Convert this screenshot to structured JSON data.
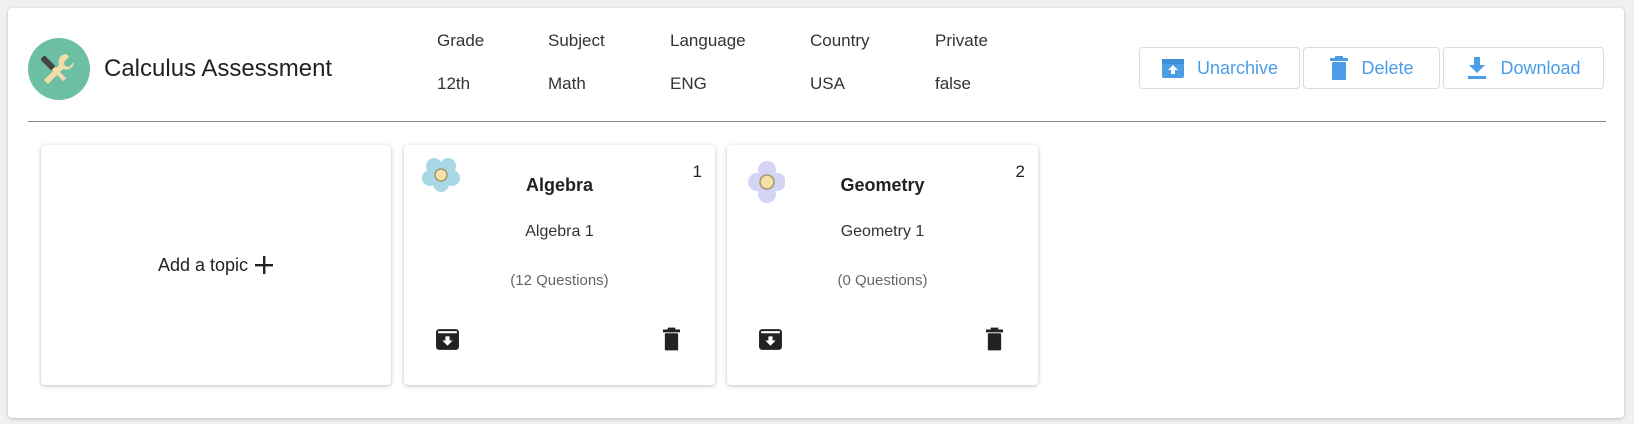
{
  "assessment": {
    "title": "Calculus Assessment",
    "logo_icon": "tools-icon",
    "logo_color": "#6dbfa3"
  },
  "meta": [
    {
      "label": "Grade",
      "value": "12th"
    },
    {
      "label": "Subject",
      "value": "Math"
    },
    {
      "label": "Language",
      "value": "ENG"
    },
    {
      "label": "Country",
      "value": "USA"
    },
    {
      "label": "Private",
      "value": "false"
    }
  ],
  "actions": {
    "unarchive": "Unarchive",
    "delete": "Delete",
    "download": "Download",
    "accent_color": "#4a9de6"
  },
  "add_topic": {
    "label": "Add a topic"
  },
  "topics": [
    {
      "number": "1",
      "name": "Algebra",
      "subtitle": "Algebra 1",
      "count": "(12 Questions)",
      "icon": "flower-icon",
      "color": "#a8d8e6"
    },
    {
      "number": "2",
      "name": "Geometry",
      "subtitle": "Geometry 1",
      "count": "(0 Questions)",
      "icon": "flower-icon",
      "color": "#d4d4f5"
    }
  ]
}
